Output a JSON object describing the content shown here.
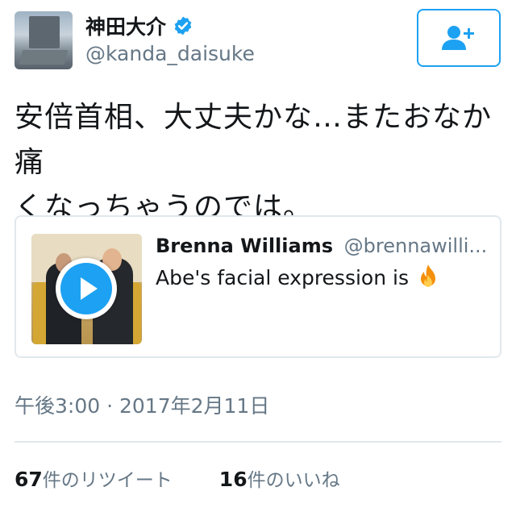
{
  "author": {
    "display_name": "神田大介",
    "handle": "@kanda_daisuke",
    "verified": true
  },
  "follow_button": {
    "icon": "add-user-icon"
  },
  "tweet": {
    "line1": "安倍首相、大丈夫かな…またおなか痛",
    "line2": "くなっちゃうのでは。"
  },
  "quote": {
    "name": "Brenna Williams",
    "handle": "@brennawilli...",
    "text": "Abe's facial expression is",
    "emoji_icon": "fire-icon",
    "media_icon": "play-icon"
  },
  "timestamp": "午後3:00 · 2017年2月11日",
  "stats": {
    "retweets_count": "67",
    "retweets_label": "件のリツイート",
    "likes_count": "16",
    "likes_label": "件のいいね"
  },
  "colors": {
    "accent": "#1da1f2",
    "secondary_text": "#657786",
    "border": "#e1e8ed"
  }
}
